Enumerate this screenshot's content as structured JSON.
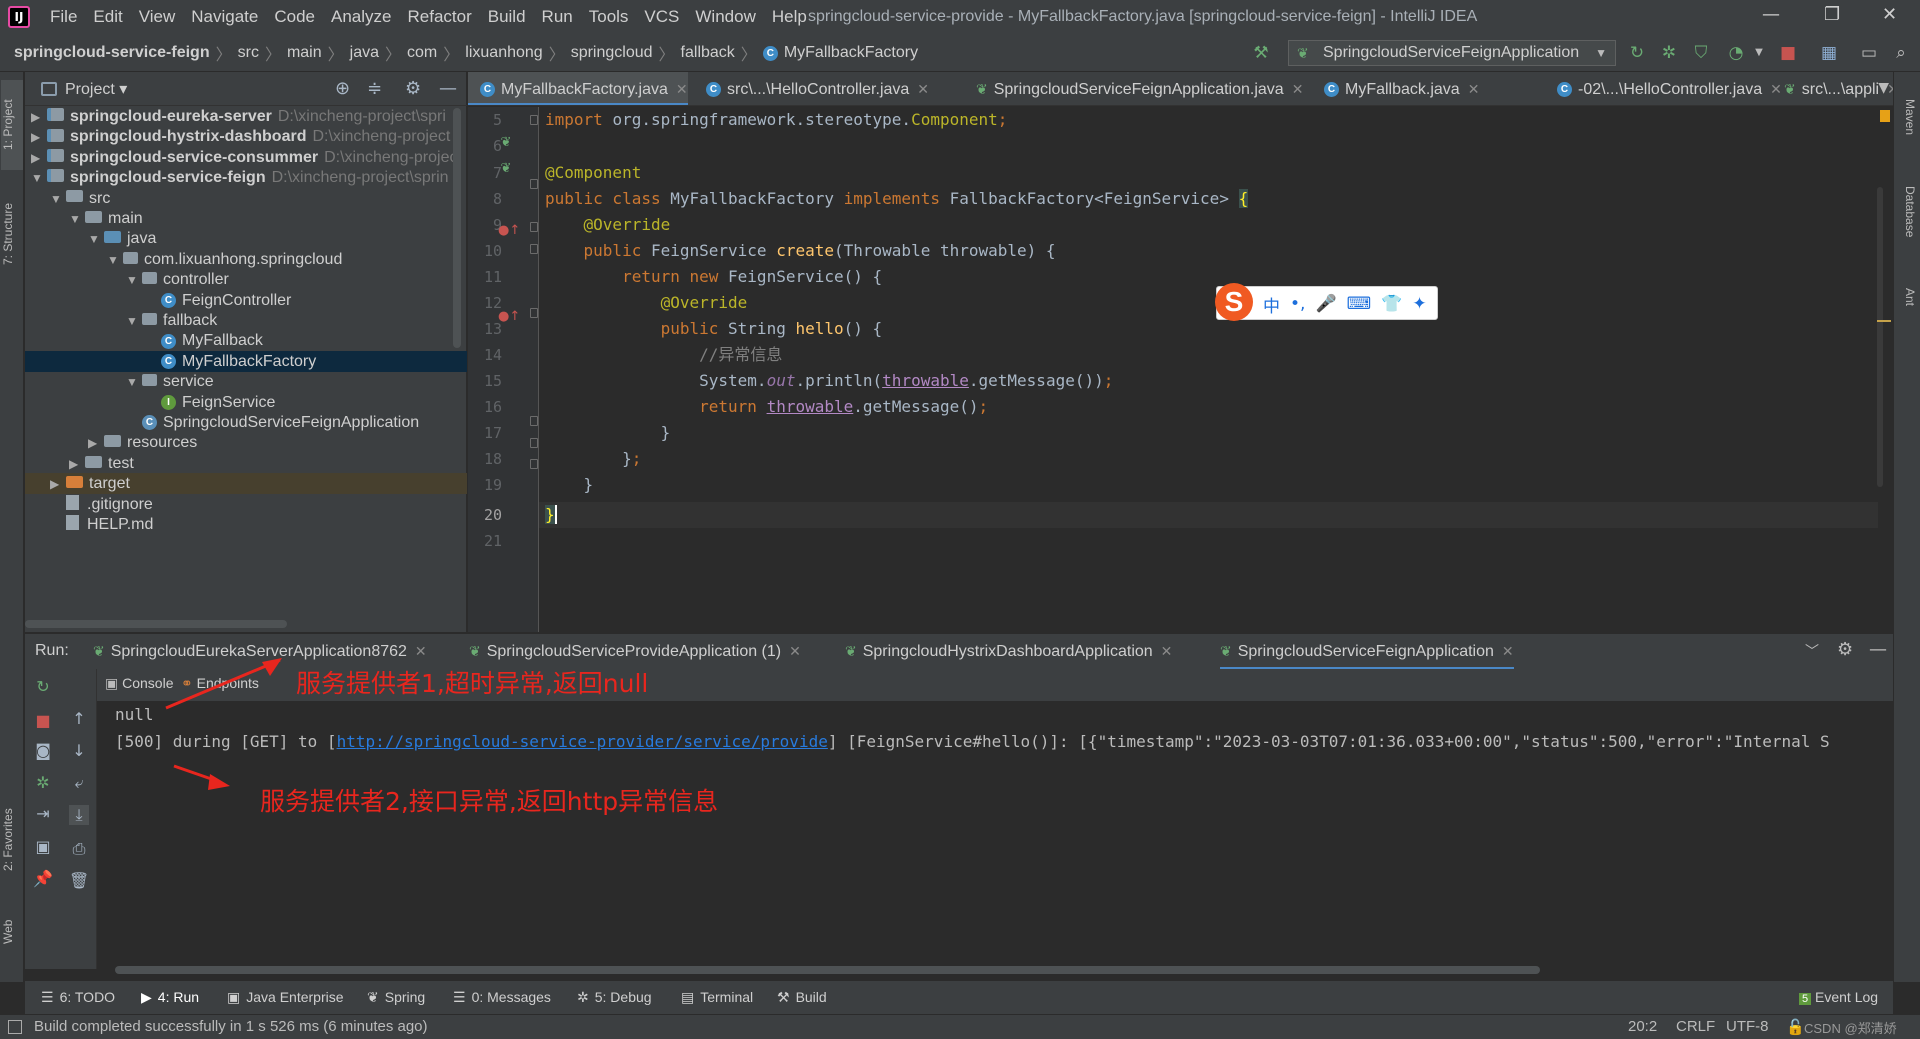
{
  "menubar": {
    "items": [
      "File",
      "Edit",
      "View",
      "Navigate",
      "Code",
      "Analyze",
      "Refactor",
      "Build",
      "Run",
      "Tools",
      "VCS",
      "Window",
      "Help"
    ],
    "window_title": "springcloud-service-provide - MyFallbackFactory.java [springcloud-service-feign] - IntelliJ IDEA"
  },
  "breadcrumb": [
    "springcloud-service-feign",
    "src",
    "main",
    "java",
    "com",
    "lixuanhong",
    "springcloud",
    "fallback",
    "MyFallbackFactory"
  ],
  "run_config": "SpringcloudServiceFeignApplication",
  "project_panel": {
    "title": "Project",
    "tree": [
      {
        "label": "springcloud-eureka-server",
        "path": "D:\\xincheng-project\\spri",
        "depth": 0,
        "arrow": "▶",
        "type": "module"
      },
      {
        "label": "springcloud-hystrix-dashboard",
        "path": "D:\\xincheng-project",
        "depth": 0,
        "arrow": "▶",
        "type": "module"
      },
      {
        "label": "springcloud-service-consummer",
        "path": "D:\\xincheng-projec",
        "depth": 0,
        "arrow": "▶",
        "type": "module"
      },
      {
        "label": "springcloud-service-feign",
        "path": "D:\\xincheng-project\\sprin",
        "depth": 0,
        "arrow": "▼",
        "type": "module"
      },
      {
        "label": "src",
        "path": "",
        "depth": 1,
        "arrow": "▼",
        "type": "folder"
      },
      {
        "label": "main",
        "path": "",
        "depth": 2,
        "arrow": "▼",
        "type": "folder"
      },
      {
        "label": "java",
        "path": "",
        "depth": 3,
        "arrow": "▼",
        "type": "folder-blue"
      },
      {
        "label": "com.lixuanhong.springcloud",
        "path": "",
        "depth": 4,
        "arrow": "▼",
        "type": "package"
      },
      {
        "label": "controller",
        "path": "",
        "depth": 5,
        "arrow": "▼",
        "type": "package"
      },
      {
        "label": "FeignController",
        "path": "",
        "depth": 6,
        "arrow": "",
        "type": "class"
      },
      {
        "label": "fallback",
        "path": "",
        "depth": 5,
        "arrow": "▼",
        "type": "package"
      },
      {
        "label": "MyFallback",
        "path": "",
        "depth": 6,
        "arrow": "",
        "type": "class"
      },
      {
        "label": "MyFallbackFactory",
        "path": "",
        "depth": 6,
        "arrow": "",
        "type": "class",
        "selected": true
      },
      {
        "label": "service",
        "path": "",
        "depth": 5,
        "arrow": "▼",
        "type": "package"
      },
      {
        "label": "FeignService",
        "path": "",
        "depth": 6,
        "arrow": "",
        "type": "interface"
      },
      {
        "label": "SpringcloudServiceFeignApplication",
        "path": "",
        "depth": 5,
        "arrow": "",
        "type": "springclass"
      },
      {
        "label": "resources",
        "path": "",
        "depth": 3,
        "arrow": "▶",
        "type": "folder"
      },
      {
        "label": "test",
        "path": "",
        "depth": 2,
        "arrow": "▶",
        "type": "folder"
      },
      {
        "label": "target",
        "path": "",
        "depth": 1,
        "arrow": "▶",
        "type": "folder-orange",
        "target": true
      },
      {
        "label": ".gitignore",
        "path": "",
        "depth": 1,
        "arrow": "",
        "type": "file"
      },
      {
        "label": "HELP.md",
        "path": "",
        "depth": 1,
        "arrow": "",
        "type": "file"
      }
    ]
  },
  "editor_tabs": [
    {
      "label": "MyFallbackFactory.java",
      "active": true,
      "icon": "c"
    },
    {
      "label": "src\\...\\HelloController.java",
      "active": false,
      "icon": "c"
    },
    {
      "label": "SpringcloudServiceFeignApplication.java",
      "active": false,
      "icon": "spring"
    },
    {
      "label": "MyFallback.java",
      "active": false,
      "icon": "c"
    },
    {
      "label": "-02\\...\\HelloController.java",
      "active": false,
      "icon": "c"
    },
    {
      "label": "src\\...\\appli",
      "active": false,
      "icon": "spring"
    }
  ],
  "code": {
    "line_numbers": [
      "5",
      "6",
      "7",
      "8",
      "9",
      "10",
      "11",
      "12",
      "13",
      "14",
      "15",
      "16",
      "17",
      "18",
      "19",
      "20",
      "21"
    ],
    "l5_import": "import ",
    "l5_pkg": "org.springframework.stereotype.",
    "l5_cls": "Component",
    "l5_semi": ";",
    "l7": "@Component",
    "l8_a": "public class ",
    "l8_b": "MyFallbackFactory ",
    "l8_c": "implements ",
    "l8_d": "FallbackFactory<FeignService> ",
    "l8_e": "{",
    "l9": "@Override",
    "l10_a": "public ",
    "l10_b": "FeignService ",
    "l10_c": "create",
    "l10_d": "(Throwable throwable) {",
    "l11_a": "return new ",
    "l11_b": "FeignService() {",
    "l12": "@Override",
    "l13_a": "public ",
    "l13_b": "String ",
    "l13_c": "hello",
    "l13_d": "() {",
    "l14": "//异常信息",
    "l15_a": "System.",
    "l15_b": "out",
    "l15_c": ".println(",
    "l15_d": "throwable",
    "l15_e": ".getMessage())",
    "l15_f": ";",
    "l16_a": "return ",
    "l16_b": "throwable",
    "l16_c": ".getMessage()",
    "l16_d": ";",
    "l17": "}",
    "l18_a": "}",
    "l18_b": ";",
    "l19": "}",
    "l20": "}"
  },
  "ime_toolbar": {
    "logo": "S",
    "items": [
      "中",
      "•,",
      "🎤",
      "⌨",
      "👕",
      "✦"
    ]
  },
  "run_panel": {
    "label": "Run:",
    "tabs": [
      {
        "label": "SpringcloudEurekaServerApplication8762",
        "active": false
      },
      {
        "label": "SpringcloudServiceProvideApplication (1)",
        "active": false
      },
      {
        "label": "SpringcloudHystrixDashboardApplication",
        "active": false
      },
      {
        "label": "SpringcloudServiceFeignApplication",
        "active": true
      }
    ],
    "subtabs": [
      "Console",
      "Endpoints"
    ],
    "console_lines": {
      "line1": "null",
      "line2_prefix": "[500] during [GET] to [",
      "line2_link": "http://springcloud-service-provider/service/provide",
      "line2_suffix": "] [FeignService#hello()]: [{\"timestamp\":\"2023-03-03T07:01:36.033+00:00\",\"status\":500,\"error\":\"Internal S"
    },
    "annotations": {
      "a1": "服务提供者1,超时异常,返回null",
      "a2": "服务提供者2,接口异常,返回http异常信息"
    }
  },
  "tool_tabs": [
    {
      "label": "6: TODO",
      "icon": "☰"
    },
    {
      "label": "4: Run",
      "icon": "▶",
      "active": true
    },
    {
      "label": "Java Enterprise",
      "icon": "▣"
    },
    {
      "label": "Spring",
      "icon": "❦"
    },
    {
      "label": "0: Messages",
      "icon": "☰"
    },
    {
      "label": "5: Debug",
      "icon": "✲"
    },
    {
      "label": "Terminal",
      "icon": "▤"
    },
    {
      "label": "Build",
      "icon": "⚒"
    }
  ],
  "event_log": "Event Log",
  "left_strip": {
    "project": "1: Project",
    "structure": "7: Structure",
    "favorites": "2: Favorites",
    "web": "Web"
  },
  "right_strip": {
    "maven": "Maven",
    "database": "Database",
    "ant": "Ant"
  },
  "status_bar": {
    "message": "Build completed successfully in 1 s 526 ms (6 minutes ago)",
    "position": "20:2",
    "line_sep": "CRLF",
    "encoding": "UTF-8",
    "watermark": "CSDN @郑清娇"
  },
  "colors": {
    "accent": "#4a88c7",
    "annotation": "#e8261e",
    "selection": "#0d293e"
  }
}
